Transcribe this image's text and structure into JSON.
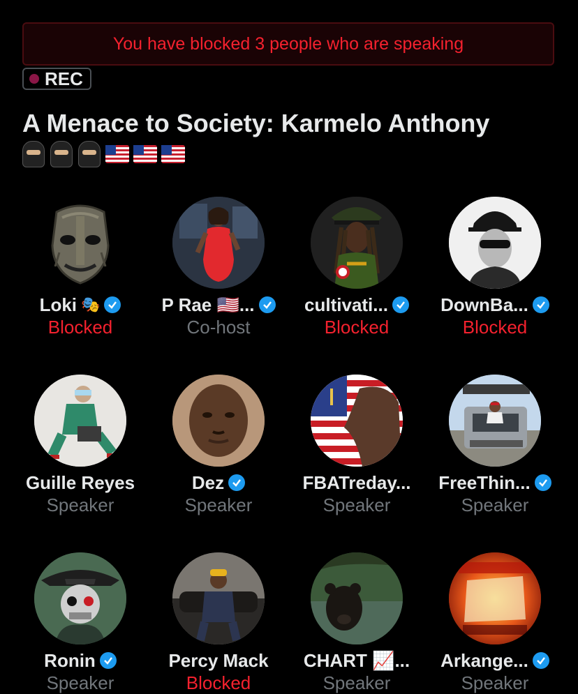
{
  "banner": {
    "text": "You have blocked 3 people who are speaking"
  },
  "recording": {
    "label": "REC"
  },
  "space": {
    "title": "A Menace to Society: Karmelo Anthony",
    "emojis": [
      "ninja",
      "ninja",
      "ninja",
      "us-flag",
      "us-flag",
      "us-flag"
    ]
  },
  "participants": [
    {
      "name": "Loki",
      "suffix_icon": "theater-masks-icon",
      "verified": true,
      "role": "Blocked",
      "avatar": "wooden-mask"
    },
    {
      "name": "P Rae 🇺🇸...",
      "verified": true,
      "role": "Co-host",
      "avatar": "woman-red-dress"
    },
    {
      "name": "cultivati...",
      "verified": true,
      "role": "Blocked",
      "avatar": "woman-cap"
    },
    {
      "name": "DownBa...",
      "verified": true,
      "role": "Blocked",
      "avatar": "man-maga-hat"
    },
    {
      "name": "Guille Reyes",
      "verified": false,
      "role": "Speaker",
      "avatar": "man-green-scrubs"
    },
    {
      "name": "Dez",
      "verified": true,
      "role": "Speaker",
      "avatar": "man-portrait"
    },
    {
      "name": "FBATreday...",
      "verified": false,
      "role": "Speaker",
      "avatar": "flag-torso"
    },
    {
      "name": "FreeThin...",
      "verified": true,
      "role": "Speaker",
      "avatar": "man-on-truck"
    },
    {
      "name": "Ronin",
      "verified": true,
      "role": "Speaker",
      "avatar": "skull-helmet"
    },
    {
      "name": "Percy Mack",
      "verified": false,
      "role": "Blocked",
      "avatar": "man-on-couch"
    },
    {
      "name": "CHART 📈...",
      "verified": false,
      "role": "Speaker",
      "avatar": "bear-in-water"
    },
    {
      "name": "Arkange...",
      "verified": true,
      "role": "Speaker",
      "avatar": "last-days-fire"
    }
  ],
  "colors": {
    "blocked": "#f4212e",
    "speaker": "#71767b",
    "verified": "#1d9bf0"
  }
}
